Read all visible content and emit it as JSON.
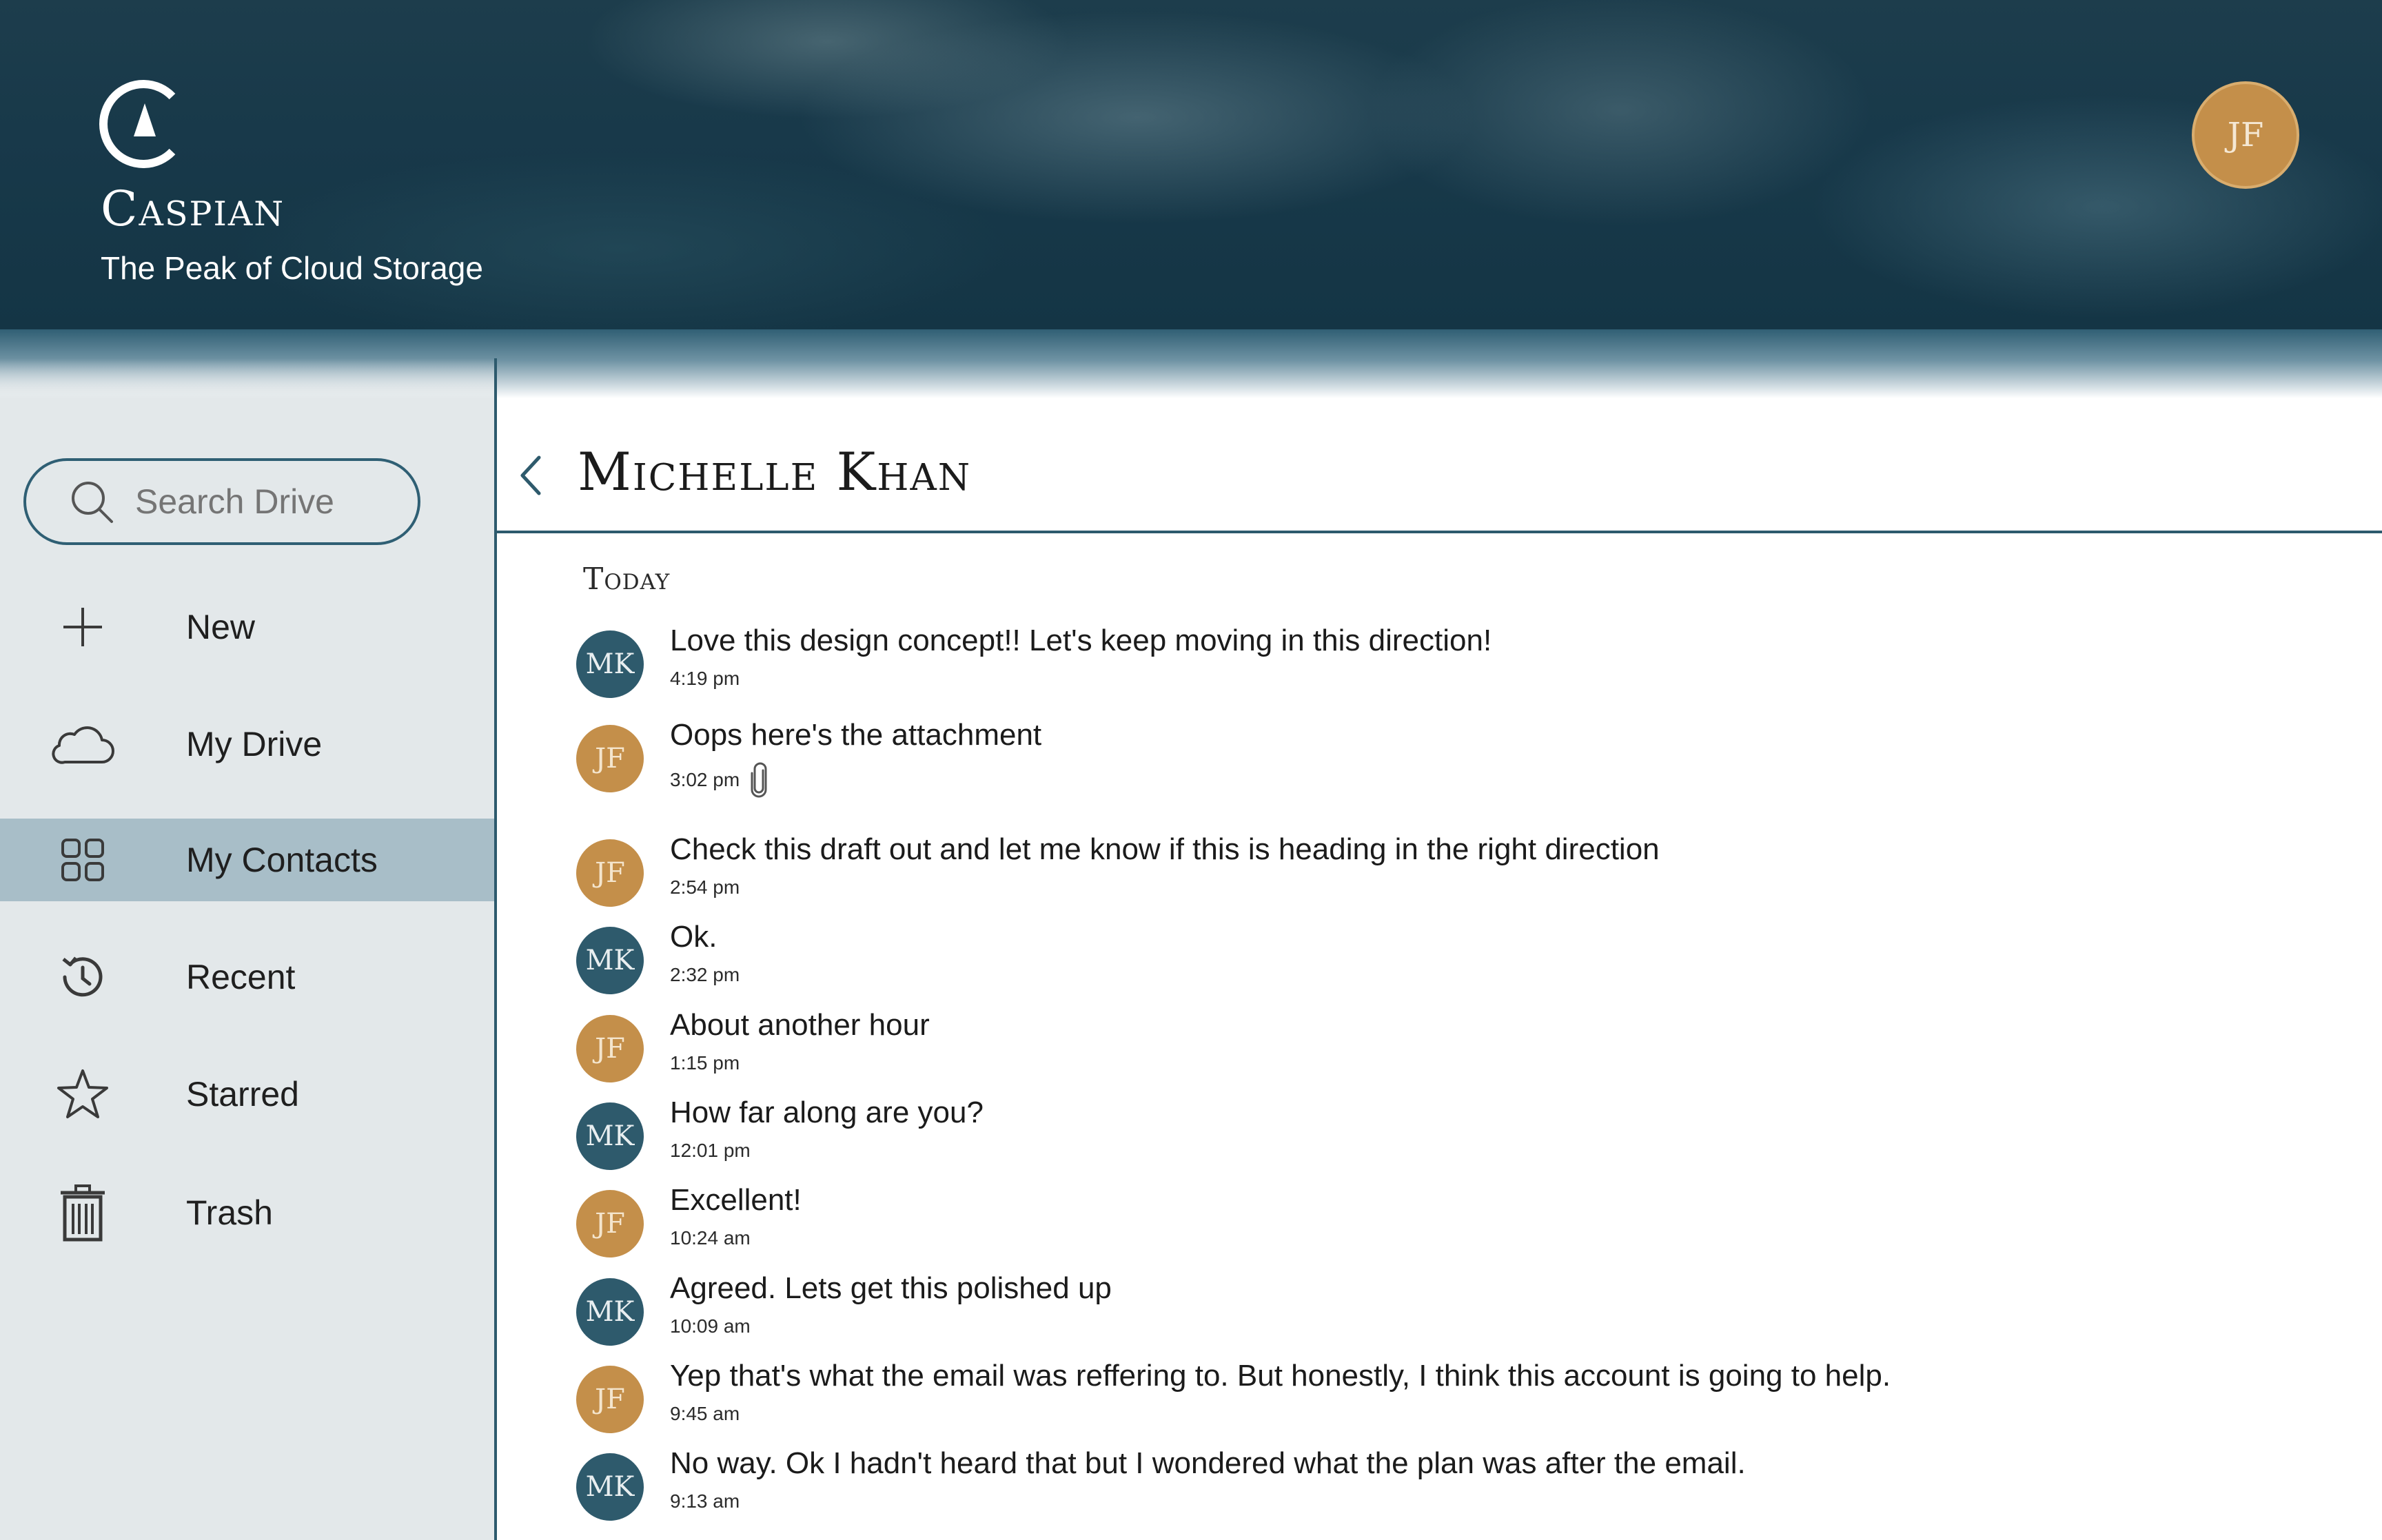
{
  "brand": {
    "name": "Caspian",
    "tagline": "The Peak of Cloud Storage"
  },
  "user": {
    "initials": "JF"
  },
  "search": {
    "placeholder": "Search Drive"
  },
  "sidebar": {
    "items": [
      {
        "label": "New",
        "icon": "plus-icon",
        "active": false
      },
      {
        "label": "My Drive",
        "icon": "cloud-icon",
        "active": false
      },
      {
        "label": "My Contacts",
        "icon": "grid-icon",
        "active": true
      },
      {
        "label": "Recent",
        "icon": "history-icon",
        "active": false
      },
      {
        "label": "Starred",
        "icon": "star-icon",
        "active": false
      },
      {
        "label": "Trash",
        "icon": "trash-icon",
        "active": false
      }
    ]
  },
  "conversation": {
    "contact_name": "Michelle Khan",
    "day_label": "Today",
    "messages": [
      {
        "initials": "MK",
        "text": "Love this design concept!! Let's keep moving in this direction!",
        "time": "4:19 pm"
      },
      {
        "initials": "JF",
        "text": "Oops here's the attachment",
        "time": "3:02 pm",
        "attachment_icon": "paperclip-icon"
      },
      {
        "initials": "JF",
        "text": "Check this draft out and let me know if this is heading in the right direction",
        "time": "2:54 pm"
      },
      {
        "initials": "MK",
        "text": "Ok.",
        "time": "2:32 pm"
      },
      {
        "initials": "JF",
        "text": "About another hour",
        "time": "1:15 pm"
      },
      {
        "initials": "MK",
        "text": "How far along are you?",
        "time": "12:01 pm"
      },
      {
        "initials": "JF",
        "text": "Excellent!",
        "time": "10:24 am"
      },
      {
        "initials": "MK",
        "text": "Agreed. Lets get this polished up",
        "time": "10:09 am"
      },
      {
        "initials": "JF",
        "text": "Yep that's what the email was reffering to. But honestly, I think this account is going to help.",
        "time": "9:45 am"
      },
      {
        "initials": "MK",
        "text": "No way. Ok I hadn't heard that but I wondered what the plan was after the email.",
        "time": "9:13 am"
      }
    ]
  },
  "colors": {
    "teal": "#2e5a6c",
    "gold": "#c48f4a",
    "sidebar_bg": "#e3e8ea",
    "active_bg": "#a8bec8"
  }
}
